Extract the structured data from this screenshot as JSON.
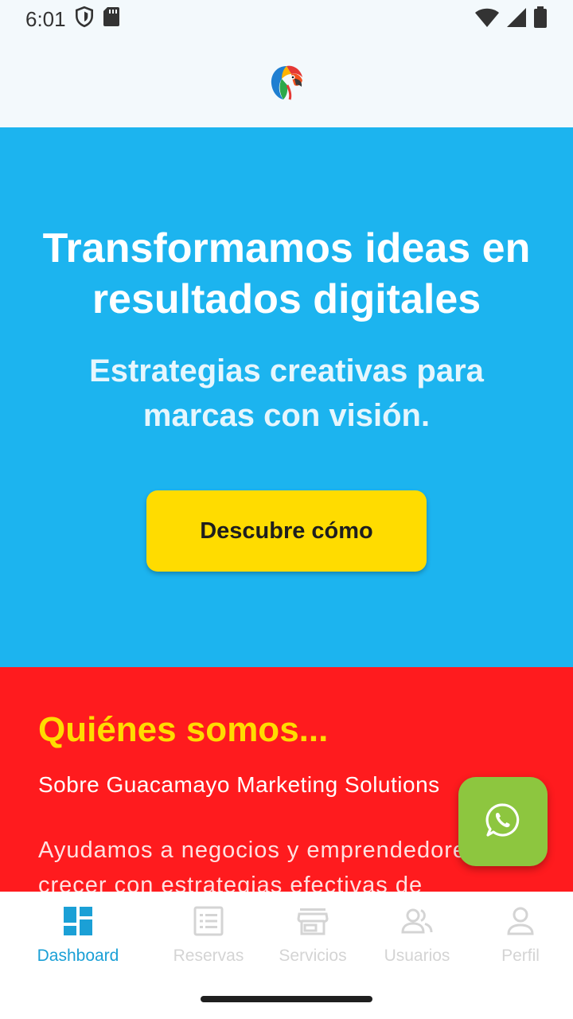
{
  "status_bar": {
    "time": "6:01",
    "icons": [
      "shield-icon",
      "sd-card-icon",
      "wifi-icon",
      "cellular-signal-icon",
      "battery-icon"
    ]
  },
  "header": {
    "logo": "guacamayo-parrot-logo"
  },
  "hero": {
    "title": "Transformamos ideas en resultados digitales",
    "subtitle": "Estrategias creativas para marcas con visión.",
    "cta_label": "Descubre cómo",
    "background_color": "#1cb4ef",
    "cta_color": "#ffdc00"
  },
  "about": {
    "title": "Quiénes somos...",
    "subtitle": "Sobre Guacamayo Marketing Solutions",
    "body": "Ayudamos a negocios y emprendedores a crecer con estrategias efectivas de",
    "background_color": "#ff1b1e",
    "title_color": "#ffdc00"
  },
  "fab": {
    "icon": "whatsapp-icon",
    "color": "#8dc63f"
  },
  "bottom_nav": {
    "active_color": "#1ba0d6",
    "items": [
      {
        "label": "Dashboard",
        "icon": "dashboard-icon",
        "active": true
      },
      {
        "label": "Reservas",
        "icon": "list-icon",
        "active": false
      },
      {
        "label": "Servicios",
        "icon": "store-icon",
        "active": false
      },
      {
        "label": "Usuarios",
        "icon": "users-icon",
        "active": false
      },
      {
        "label": "Perfil",
        "icon": "person-icon",
        "active": false
      }
    ]
  }
}
